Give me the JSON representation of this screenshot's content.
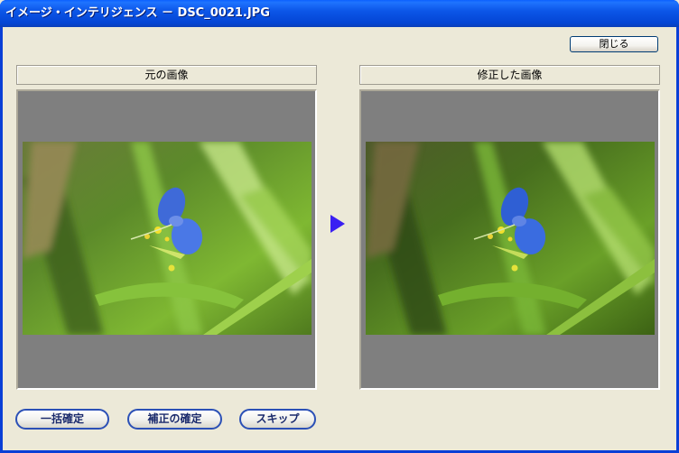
{
  "window": {
    "title": "イメージ・インテリジェンス － DSC_0021.JPG"
  },
  "toolbar": {
    "close_label": "閉じる"
  },
  "panels": {
    "original": {
      "label": "元の画像"
    },
    "corrected": {
      "label": "修正した画像"
    }
  },
  "buttons": {
    "batch_confirm": "一括確定",
    "confirm_correction": "補正の確定",
    "skip": "スキップ"
  },
  "icons": {
    "arrow": "right-triangle-arrow-icon"
  },
  "colors": {
    "titlebar": "#0c56e8",
    "arrow": "#3a1ff2",
    "panel_bg": "#7f7f7f",
    "window_bg": "#ece9d8"
  }
}
